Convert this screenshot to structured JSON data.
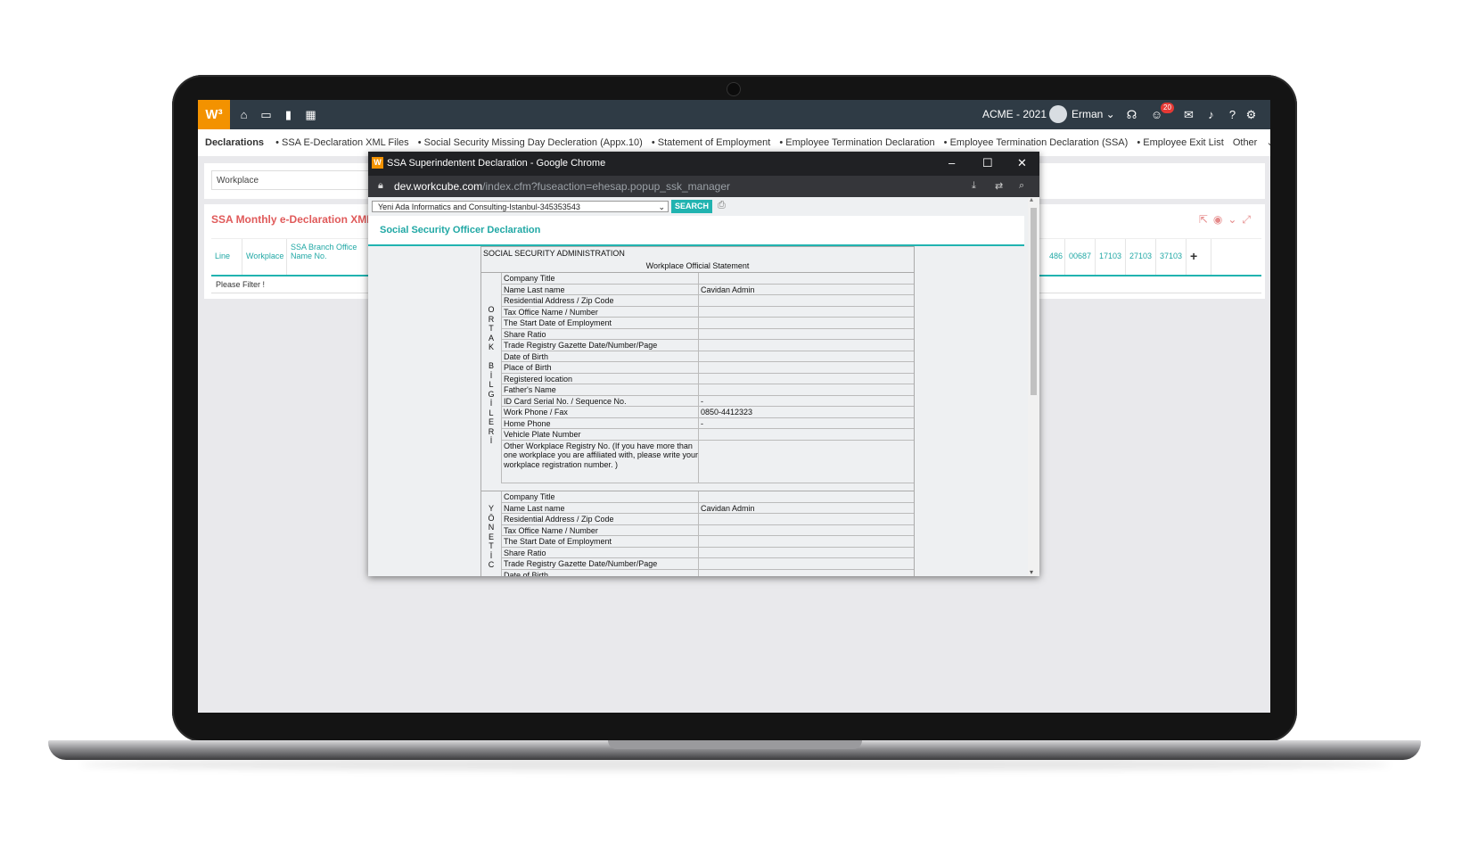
{
  "app": {
    "logo": "W³",
    "company_period": "ACME - 2021",
    "user": "Erman",
    "notification_count": "20"
  },
  "subnav": {
    "active": "Declarations",
    "items": [
      "• SSA E-Declaration XML Files",
      "• Social Security Missing Day Decleration (Appx.10)",
      "• Statement of Employment",
      "• Employee Termination Declaration",
      "• Employee Termination Declaration (SSA)",
      "• Employee Exit List",
      "Other"
    ]
  },
  "filter": {
    "workplace_placeholder": "Workplace"
  },
  "panel": {
    "title": "SSA Monthly e-Declaration XML File l",
    "columns": [
      "Line",
      "Workplace",
      "SSA Branch Office Name No."
    ],
    "right_columns": [
      "486",
      "00687",
      "17103",
      "27103",
      "37103"
    ],
    "empty_text": "Please Filter !"
  },
  "popup": {
    "window_title": "SSA Superindentent Declaration - Google Chrome",
    "url_host": "dev.workcube.com",
    "url_path": "/index.cfm?fuseaction=ehesap.popup_ssk_manager",
    "select_value": "Yeni Ada Informatics and Consulting-Istanbul-345353543",
    "search_label": "SEARCH",
    "page_title": "Social Security Officer Declaration",
    "doc_header": "SOCIAL SECURITY ADMINISTRATION",
    "doc_subheader": "Workplace Official Statement",
    "section1_vertical": "O R T A K  B İ L G İ L E R İ",
    "section1": [
      {
        "label": "Company Title",
        "value": ""
      },
      {
        "label": "Name Last name",
        "value": "Cavidan Admin"
      },
      {
        "label": "Residential Address / Zip Code",
        "value": ""
      },
      {
        "label": "Tax Office Name / Number",
        "value": ""
      },
      {
        "label": "The Start Date of Employment",
        "value": ""
      },
      {
        "label": "Share Ratio",
        "value": ""
      },
      {
        "label": "Trade Registry Gazette Date/Number/Page",
        "value": ""
      },
      {
        "label": "Date of Birth",
        "value": ""
      },
      {
        "label": "Place of Birth",
        "value": ""
      },
      {
        "label": "Registered location",
        "value": ""
      },
      {
        "label": "Father's Name",
        "value": ""
      },
      {
        "label": "ID Card Serial No. / Sequence No.",
        "value": "-"
      },
      {
        "label": "Work Phone / Fax",
        "value": "0850-4412323"
      },
      {
        "label": "Home Phone",
        "value": "-"
      },
      {
        "label": "Vehicle Plate Number",
        "value": ""
      }
    ],
    "section1_last": "Other Workplace Registry No. (If you have more than one workplace you are affiliated with, please write your workplace registration number. )",
    "section2_vertical": "Y Ö N E T İ C",
    "section2": [
      {
        "label": "Company Title",
        "value": ""
      },
      {
        "label": "Name Last name",
        "value": "Cavidan Admin"
      },
      {
        "label": "Residential Address / Zip Code",
        "value": ""
      },
      {
        "label": "Tax Office Name / Number",
        "value": ""
      },
      {
        "label": "The Start Date of Employment",
        "value": ""
      },
      {
        "label": "Share Ratio",
        "value": ""
      },
      {
        "label": "Trade Registry Gazette Date/Number/Page",
        "value": ""
      },
      {
        "label": "Date of Birth",
        "value": ""
      }
    ]
  },
  "colors": {
    "accent": "#21b3b0",
    "brand": "#f39200",
    "title_red": "#e05a5a",
    "topbar": "#2f3b45"
  }
}
